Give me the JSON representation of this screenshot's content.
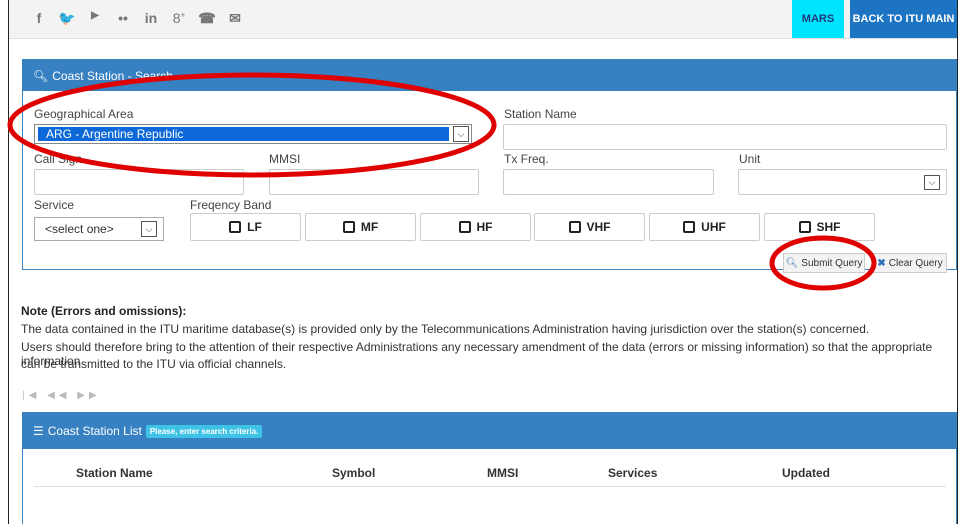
{
  "topbar": {
    "social_icons": [
      "facebook-icon",
      "twitter-icon",
      "youtube-icon",
      "flickr-icon",
      "linkedin-icon",
      "googleplus-icon",
      "phone-icon",
      "email-icon"
    ],
    "social_glyphs": [
      "f",
      "ὂ6",
      "▶",
      "••",
      "in",
      "8+",
      "☎",
      "✉"
    ],
    "mars_label": "MARS",
    "back_label": "BACK TO ITU MAIN"
  },
  "search": {
    "title": "Coast Station - Search",
    "geo_label": "Geographical Area",
    "geo_value": "ARG - Argentine Republic",
    "station_name_label": "Station Name",
    "call_sign_label": "Call Sign",
    "mmsi_label": "MMSI",
    "tx_freq_label": "Tx Freq.",
    "unit_label": "Unit",
    "service_label": "Service",
    "service_value": "<select one>",
    "band_label": "Freqency Band",
    "bands": [
      "LF",
      "MF",
      "HF",
      "VHF",
      "UHF",
      "SHF"
    ],
    "submit_label": "Submit Query",
    "clear_label": "Clear Query"
  },
  "note": {
    "title": "Note (Errors and omissions):",
    "line1": "The data contained in the ITU maritime database(s) is provided only by the Telecommunications Administration having jurisdiction over the station(s) concerned.",
    "line2": "Users should therefore bring to the attention of their respective Administrations any necessary amendment of the data (errors or missing information) so that the appropriate information",
    "line3": "can be transmitted to the ITU via official channels."
  },
  "list": {
    "title": "Coast Station List",
    "badge": "Please, enter search criteria.",
    "columns": [
      "Station Name",
      "Symbol",
      "MMSI",
      "Services",
      "Updated"
    ]
  },
  "colors": {
    "accent": "#3780c1",
    "mars": "#00e5ff",
    "annotation": "#e00000"
  }
}
